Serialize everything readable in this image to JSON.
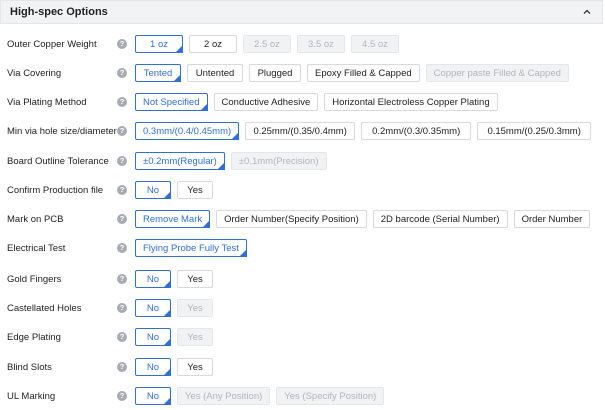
{
  "header": {
    "title": "High-spec Options"
  },
  "rows": [
    {
      "label": "Outer Copper Weight",
      "options": [
        {
          "text": "1 oz",
          "state": "selected"
        },
        {
          "text": "2 oz",
          "state": "normal"
        },
        {
          "text": "2.5 oz",
          "state": "disabled"
        },
        {
          "text": "3.5 oz",
          "state": "disabled"
        },
        {
          "text": "4.5 oz",
          "state": "disabled"
        }
      ]
    },
    {
      "label": "Via Covering",
      "options": [
        {
          "text": "Tented",
          "state": "selected"
        },
        {
          "text": "Untented",
          "state": "normal"
        },
        {
          "text": "Plugged",
          "state": "normal"
        },
        {
          "text": "Epoxy Filled & Capped",
          "state": "normal"
        },
        {
          "text": "Copper paste Filled & Capped",
          "state": "disabled"
        }
      ]
    },
    {
      "label": "Via Plating Method",
      "options": [
        {
          "text": "Not Specified",
          "state": "selected"
        },
        {
          "text": "Conductive Adhesive",
          "state": "normal"
        },
        {
          "text": "Horizontal Electroless Copper Plating",
          "state": "normal"
        }
      ]
    },
    {
      "label": "Min via hole size/diameter",
      "options": [
        {
          "text": "0.3mm/(0.4/0.45mm)",
          "state": "selected"
        },
        {
          "text": "0.25mm/(0.35/0.4mm)",
          "state": "normal"
        },
        {
          "text": "0.2mm/(0.3/0.35mm)",
          "state": "normal"
        },
        {
          "text": "0.15mm/(0.25/0.3mm)",
          "state": "normal"
        }
      ]
    },
    {
      "label": "Board Outline Tolerance",
      "options": [
        {
          "text": "±0.2mm(Regular)",
          "state": "selected"
        },
        {
          "text": "±0.1mm(Precision)",
          "state": "disabled"
        }
      ]
    },
    {
      "label": "Confirm Production file",
      "options": [
        {
          "text": "No",
          "state": "selected"
        },
        {
          "text": "Yes",
          "state": "normal"
        }
      ]
    },
    {
      "label": "Mark on PCB",
      "options": [
        {
          "text": "Remove Mark",
          "state": "selected"
        },
        {
          "text": "Order Number(Specify Position)",
          "state": "normal"
        },
        {
          "text": "2D barcode (Serial Number)",
          "state": "normal"
        },
        {
          "text": "Order Number",
          "state": "normal"
        }
      ]
    },
    {
      "label": "Electrical Test",
      "options": [
        {
          "text": "Flying Probe Fully Test",
          "state": "selected"
        }
      ]
    },
    {
      "label": "Gold Fingers",
      "options": [
        {
          "text": "No",
          "state": "selected"
        },
        {
          "text": "Yes",
          "state": "normal"
        }
      ]
    },
    {
      "label": "Castellated Holes",
      "options": [
        {
          "text": "No",
          "state": "selected"
        },
        {
          "text": "Yes",
          "state": "disabled"
        }
      ]
    },
    {
      "label": "Edge Plating",
      "options": [
        {
          "text": "No",
          "state": "selected"
        },
        {
          "text": "Yes",
          "state": "disabled"
        }
      ]
    },
    {
      "label": "Blind Slots",
      "options": [
        {
          "text": "No",
          "state": "selected"
        },
        {
          "text": "Yes",
          "state": "normal"
        }
      ]
    },
    {
      "label": "UL Marking",
      "options": [
        {
          "text": "No",
          "state": "selected"
        },
        {
          "text": "Yes (Any Position)",
          "state": "disabled"
        },
        {
          "text": "Yes (Specify Position)",
          "state": "disabled"
        }
      ]
    }
  ],
  "icons": {
    "help": "help-icon",
    "collapse": "chevron-up-icon"
  },
  "colors": {
    "accent": "#2f6fd6",
    "disabled_bg": "#f1f2f4",
    "header_bg": "#f2f3f5"
  }
}
